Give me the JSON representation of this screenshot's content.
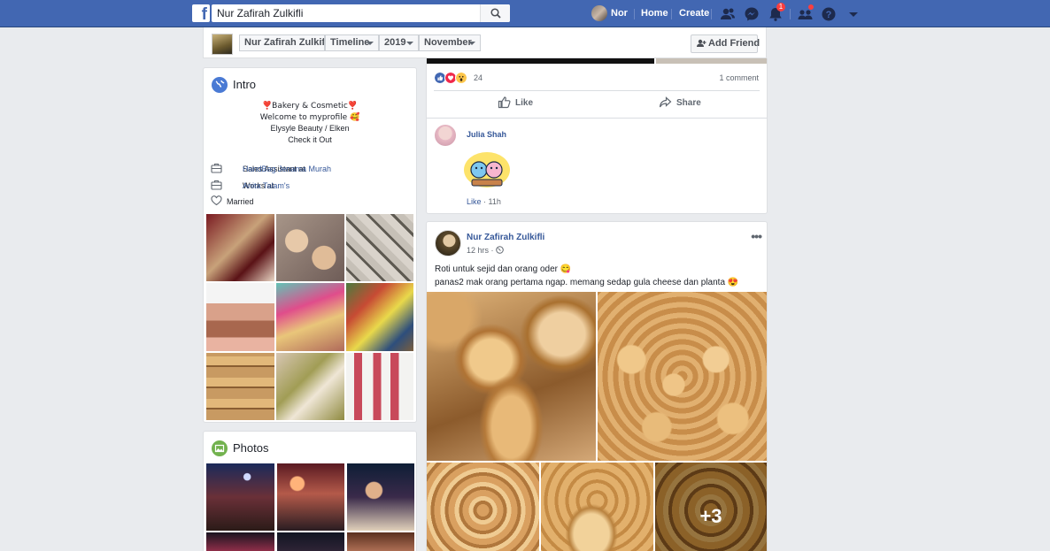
{
  "topbar": {
    "logo": "f",
    "search_value": "Nur Zafirah Zulkifli",
    "user_name": "Nor",
    "home": "Home",
    "create": "Create",
    "notification_count": "1"
  },
  "timeline_header": {
    "name": "Nur Zafirah Zulkifli",
    "timeline": "Timeline",
    "year": "2019",
    "month": "November",
    "add_friend": "Add Friend"
  },
  "intro": {
    "title": "Intro",
    "bio_lines": [
      "❣️Bakery & Cosmetic❣️",
      "Welcome to myprofile 🥰",
      "Elysyle Beauty / Elken",
      "Check it Out"
    ],
    "work1_prefix": "Sales Assistant at ",
    "work1_link": "HandBag Jenama Murah",
    "work2_prefix": "Works at ",
    "work2_link": "Anita Talam's",
    "relationship": "Married"
  },
  "photos": {
    "title": "Photos"
  },
  "post1": {
    "reaction_count": "24",
    "comment_count": "1 comment",
    "like": "Like",
    "share": "Share",
    "comment": {
      "author": "Julia Shah",
      "like": "Like",
      "time": "11h"
    }
  },
  "post2": {
    "author": "Nur Zafirah Zulkifli",
    "time": "12 hrs ·",
    "more": "•••",
    "text_line1": "Roti untuk sejid dan orang oder 😋",
    "text_line2": "panas2 mak orang pertama ngap. memang sedap gula cheese dan planta 😍",
    "more_photos": "+3"
  },
  "colors": {
    "brand": "#4267b2",
    "link": "#365899",
    "background": "#e9ebee"
  }
}
